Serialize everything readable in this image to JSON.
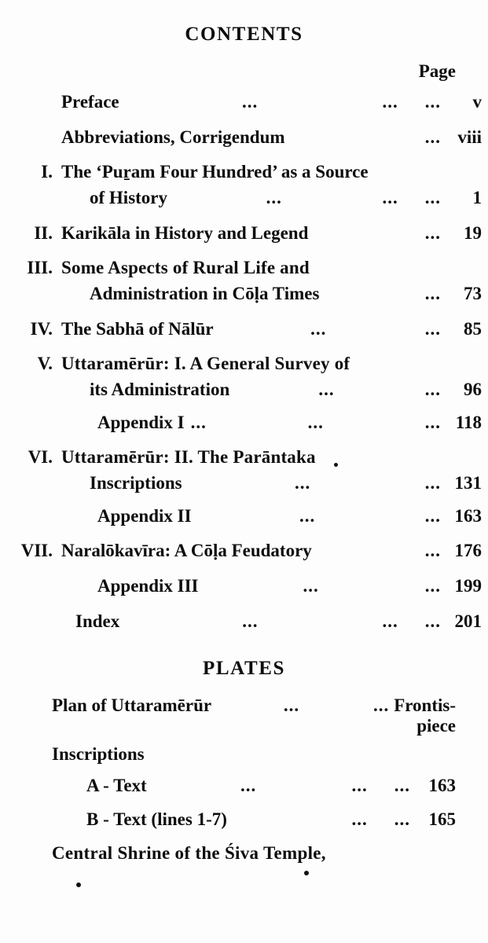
{
  "contents": {
    "title": "CONTENTS",
    "page_column_header": "Page",
    "dots": "...",
    "front_matter": [
      {
        "label": "Preface",
        "page": "v"
      },
      {
        "label": "Abbreviations, Corrigendum",
        "page": "viii"
      }
    ],
    "chapters": [
      {
        "numeral": "I.",
        "line1": "The ‘Puṟam Four Hundred’ as a Source",
        "line2": "of History",
        "page": "1"
      },
      {
        "numeral": "II.",
        "line1": "Karikāla in History and Legend",
        "page": "19"
      },
      {
        "numeral": "III.",
        "line1": "Some   Aspects   of   Rural   Life   and",
        "line2": "Administration in Cōḷa Times",
        "page": "73"
      },
      {
        "numeral": "IV.",
        "line1": "The Sabhā of Nālūr",
        "page": "85"
      },
      {
        "numeral": "V.",
        "line1": "Uttaramērūr: I. A General Survey of",
        "line2": "its Administration",
        "page": "96",
        "appendix": {
          "label": "Appendix I",
          "page": "118"
        }
      },
      {
        "numeral": "VI.",
        "line1": "Uttaramērūr:  II.   The  Parāntaka",
        "line2": "Inscriptions",
        "page": "131",
        "appendix": {
          "label": "Appendix II",
          "page": "163"
        }
      },
      {
        "numeral": "VII.",
        "line1": "Naralōkavīra:  A Cōḷa Feudatory",
        "page": "176",
        "appendix": {
          "label": "Appendix III",
          "page": "199"
        }
      }
    ],
    "index": {
      "label": "Index",
      "page": "201"
    }
  },
  "plates": {
    "title": "PLATES",
    "dots": "...",
    "rows": [
      {
        "label": "Plan of Uttaramērūr",
        "page": "Frontis-",
        "page_cont": "piece"
      },
      {
        "label": "Inscriptions"
      },
      {
        "label": "A - Text",
        "page": "163"
      },
      {
        "label": "B - Text (lines 1-7)",
        "page": "165"
      },
      {
        "label": "Central  Shrine  of  the  Śiva  Temple,"
      }
    ]
  }
}
